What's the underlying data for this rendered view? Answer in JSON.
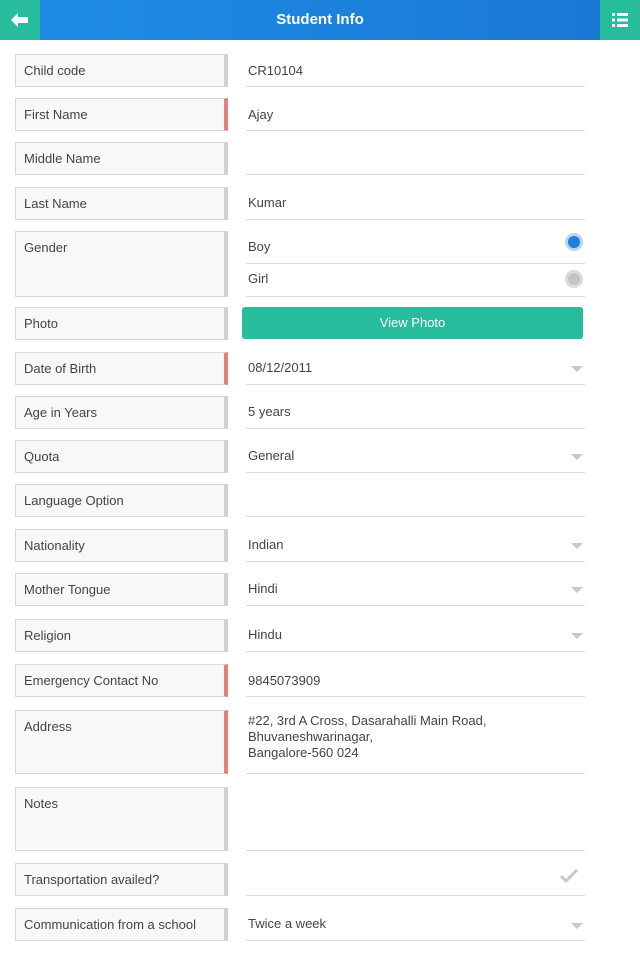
{
  "header": {
    "title": "Student Info",
    "back_icon": "arrow-left-icon",
    "menu_icon": "list-icon"
  },
  "fields": {
    "child_code": {
      "label": "Child code",
      "value": "CR10104"
    },
    "first_name": {
      "label": "First Name",
      "value": "Ajay"
    },
    "middle_name": {
      "label": "Middle Name",
      "value": ""
    },
    "last_name": {
      "label": "Last Name",
      "value": "Kumar"
    },
    "gender": {
      "label": "Gender",
      "options": [
        "Boy",
        "Girl"
      ],
      "selected": "Boy"
    },
    "photo": {
      "label": "Photo",
      "button": "View Photo"
    },
    "dob": {
      "label": "Date of Birth",
      "value": "08/12/2011"
    },
    "age": {
      "label": "Age in Years",
      "value": "5 years"
    },
    "quota": {
      "label": "Quota",
      "value": "General"
    },
    "language": {
      "label": "Language Option",
      "value": ""
    },
    "nationality": {
      "label": "Nationality",
      "value": "Indian"
    },
    "mother_tongue": {
      "label": "Mother Tongue",
      "value": "Hindi"
    },
    "religion": {
      "label": "Religion",
      "value": "Hindu"
    },
    "emergency": {
      "label": "Emergency Contact No",
      "value": "9845073909"
    },
    "address": {
      "label": "Address",
      "lines": [
        "#22, 3rd A Cross, Dasarahalli Main Road,",
        "Bhuvaneshwarinagar,",
        "Bangalore-560 024"
      ]
    },
    "notes": {
      "label": "Notes",
      "value": ""
    },
    "transport": {
      "label": "Transportation availed?",
      "checked": false
    },
    "communication": {
      "label": "Communication from a school",
      "value": "Twice a week"
    }
  },
  "colors": {
    "header": "#1e8ee6",
    "accent": "#27bc9c",
    "required": "#e57f7b",
    "radio_on": "#1e7fdc"
  }
}
